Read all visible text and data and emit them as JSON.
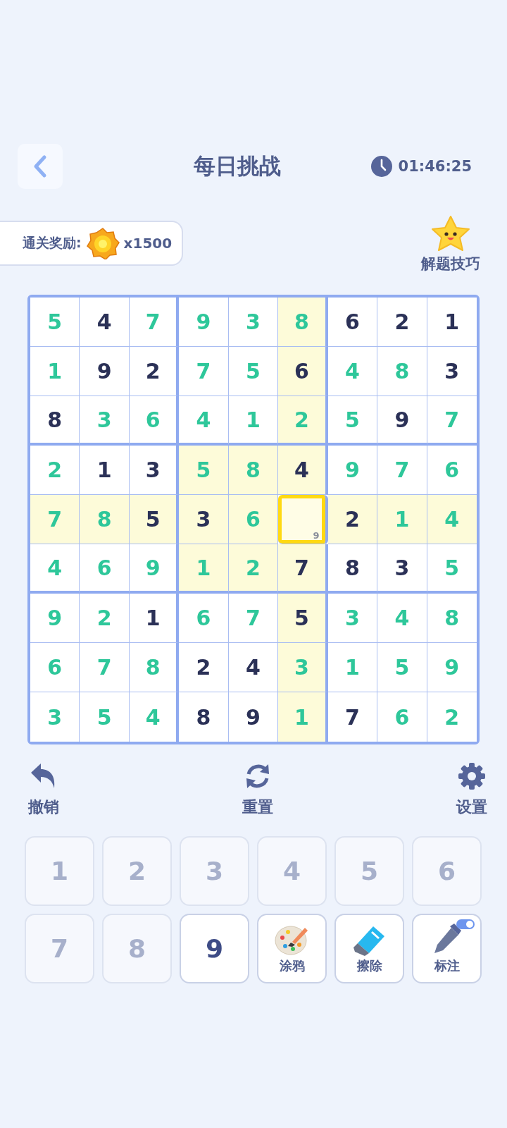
{
  "header": {
    "title": "每日挑战",
    "timer": "01:46:25"
  },
  "reward": {
    "label": "通关奖励:",
    "amount": "x1500"
  },
  "tips": {
    "label": "解题技巧"
  },
  "grid": {
    "rows": [
      [
        {
          "value": "5",
          "given": false,
          "highlighted": false,
          "selected": false
        },
        {
          "value": "4",
          "given": true,
          "highlighted": false,
          "selected": false
        },
        {
          "value": "7",
          "given": false,
          "highlighted": false,
          "selected": false
        },
        {
          "value": "9",
          "given": false,
          "highlighted": false,
          "selected": false
        },
        {
          "value": "3",
          "given": false,
          "highlighted": false,
          "selected": false
        },
        {
          "value": "8",
          "given": false,
          "highlighted": true,
          "selected": false
        },
        {
          "value": "6",
          "given": true,
          "highlighted": false,
          "selected": false
        },
        {
          "value": "2",
          "given": true,
          "highlighted": false,
          "selected": false
        },
        {
          "value": "1",
          "given": true,
          "highlighted": false,
          "selected": false
        }
      ],
      [
        {
          "value": "1",
          "given": false,
          "highlighted": false,
          "selected": false
        },
        {
          "value": "9",
          "given": true,
          "highlighted": false,
          "selected": false
        },
        {
          "value": "2",
          "given": true,
          "highlighted": false,
          "selected": false
        },
        {
          "value": "7",
          "given": false,
          "highlighted": false,
          "selected": false
        },
        {
          "value": "5",
          "given": false,
          "highlighted": false,
          "selected": false
        },
        {
          "value": "6",
          "given": true,
          "highlighted": true,
          "selected": false
        },
        {
          "value": "4",
          "given": false,
          "highlighted": false,
          "selected": false
        },
        {
          "value": "8",
          "given": false,
          "highlighted": false,
          "selected": false
        },
        {
          "value": "3",
          "given": true,
          "highlighted": false,
          "selected": false
        }
      ],
      [
        {
          "value": "8",
          "given": true,
          "highlighted": false,
          "selected": false
        },
        {
          "value": "3",
          "given": false,
          "highlighted": false,
          "selected": false
        },
        {
          "value": "6",
          "given": false,
          "highlighted": false,
          "selected": false
        },
        {
          "value": "4",
          "given": false,
          "highlighted": false,
          "selected": false
        },
        {
          "value": "1",
          "given": false,
          "highlighted": false,
          "selected": false
        },
        {
          "value": "2",
          "given": false,
          "highlighted": true,
          "selected": false
        },
        {
          "value": "5",
          "given": false,
          "highlighted": false,
          "selected": false
        },
        {
          "value": "9",
          "given": true,
          "highlighted": false,
          "selected": false
        },
        {
          "value": "7",
          "given": false,
          "highlighted": false,
          "selected": false
        }
      ],
      [
        {
          "value": "2",
          "given": false,
          "highlighted": false,
          "selected": false
        },
        {
          "value": "1",
          "given": true,
          "highlighted": false,
          "selected": false
        },
        {
          "value": "3",
          "given": true,
          "highlighted": false,
          "selected": false
        },
        {
          "value": "5",
          "given": false,
          "highlighted": true,
          "selected": false
        },
        {
          "value": "8",
          "given": false,
          "highlighted": true,
          "selected": false
        },
        {
          "value": "4",
          "given": true,
          "highlighted": true,
          "selected": false
        },
        {
          "value": "9",
          "given": false,
          "highlighted": false,
          "selected": false
        },
        {
          "value": "7",
          "given": false,
          "highlighted": false,
          "selected": false
        },
        {
          "value": "6",
          "given": false,
          "highlighted": false,
          "selected": false
        }
      ],
      [
        {
          "value": "7",
          "given": false,
          "highlighted": true,
          "selected": false
        },
        {
          "value": "8",
          "given": false,
          "highlighted": true,
          "selected": false
        },
        {
          "value": "5",
          "given": true,
          "highlighted": true,
          "selected": false
        },
        {
          "value": "3",
          "given": true,
          "highlighted": true,
          "selected": false
        },
        {
          "value": "6",
          "given": false,
          "highlighted": true,
          "selected": false
        },
        {
          "note": "9",
          "highlighted": false,
          "selected": true
        },
        {
          "value": "2",
          "given": true,
          "highlighted": true,
          "selected": false
        },
        {
          "value": "1",
          "given": false,
          "highlighted": true,
          "selected": false
        },
        {
          "value": "4",
          "given": false,
          "highlighted": true,
          "selected": false
        }
      ],
      [
        {
          "value": "4",
          "given": false,
          "highlighted": false,
          "selected": false
        },
        {
          "value": "6",
          "given": false,
          "highlighted": false,
          "selected": false
        },
        {
          "value": "9",
          "given": false,
          "highlighted": false,
          "selected": false
        },
        {
          "value": "1",
          "given": false,
          "highlighted": true,
          "selected": false
        },
        {
          "value": "2",
          "given": false,
          "highlighted": true,
          "selected": false
        },
        {
          "value": "7",
          "given": true,
          "highlighted": true,
          "selected": false
        },
        {
          "value": "8",
          "given": true,
          "highlighted": false,
          "selected": false
        },
        {
          "value": "3",
          "given": true,
          "highlighted": false,
          "selected": false
        },
        {
          "value": "5",
          "given": false,
          "highlighted": false,
          "selected": false
        }
      ],
      [
        {
          "value": "9",
          "given": false,
          "highlighted": false,
          "selected": false
        },
        {
          "value": "2",
          "given": false,
          "highlighted": false,
          "selected": false
        },
        {
          "value": "1",
          "given": true,
          "highlighted": false,
          "selected": false
        },
        {
          "value": "6",
          "given": false,
          "highlighted": false,
          "selected": false
        },
        {
          "value": "7",
          "given": false,
          "highlighted": false,
          "selected": false
        },
        {
          "value": "5",
          "given": true,
          "highlighted": true,
          "selected": false
        },
        {
          "value": "3",
          "given": false,
          "highlighted": false,
          "selected": false
        },
        {
          "value": "4",
          "given": false,
          "highlighted": false,
          "selected": false
        },
        {
          "value": "8",
          "given": false,
          "highlighted": false,
          "selected": false
        }
      ],
      [
        {
          "value": "6",
          "given": false,
          "highlighted": false,
          "selected": false
        },
        {
          "value": "7",
          "given": false,
          "highlighted": false,
          "selected": false
        },
        {
          "value": "8",
          "given": false,
          "highlighted": false,
          "selected": false
        },
        {
          "value": "2",
          "given": true,
          "highlighted": false,
          "selected": false
        },
        {
          "value": "4",
          "given": true,
          "highlighted": false,
          "selected": false
        },
        {
          "value": "3",
          "given": false,
          "highlighted": true,
          "selected": false
        },
        {
          "value": "1",
          "given": false,
          "highlighted": false,
          "selected": false
        },
        {
          "value": "5",
          "given": false,
          "highlighted": false,
          "selected": false
        },
        {
          "value": "9",
          "given": false,
          "highlighted": false,
          "selected": false
        }
      ],
      [
        {
          "value": "3",
          "given": false,
          "highlighted": false,
          "selected": false
        },
        {
          "value": "5",
          "given": false,
          "highlighted": false,
          "selected": false
        },
        {
          "value": "4",
          "given": false,
          "highlighted": false,
          "selected": false
        },
        {
          "value": "8",
          "given": true,
          "highlighted": false,
          "selected": false
        },
        {
          "value": "9",
          "given": true,
          "highlighted": false,
          "selected": false
        },
        {
          "value": "1",
          "given": false,
          "highlighted": true,
          "selected": false
        },
        {
          "value": "7",
          "given": true,
          "highlighted": false,
          "selected": false
        },
        {
          "value": "6",
          "given": false,
          "highlighted": false,
          "selected": false
        },
        {
          "value": "2",
          "given": false,
          "highlighted": false,
          "selected": false
        }
      ]
    ]
  },
  "actions": [
    {
      "kind": "undo",
      "label": "撤销"
    },
    {
      "kind": "reset",
      "label": "重置"
    },
    {
      "kind": "settings",
      "label": "设置"
    }
  ],
  "keypad": [
    {
      "kind": "digit",
      "label": "1",
      "disabled": true
    },
    {
      "kind": "digit",
      "label": "2",
      "disabled": true
    },
    {
      "kind": "digit",
      "label": "3",
      "disabled": true
    },
    {
      "kind": "digit",
      "label": "4",
      "disabled": true
    },
    {
      "kind": "digit",
      "label": "5",
      "disabled": true
    },
    {
      "kind": "digit",
      "label": "6",
      "disabled": true
    },
    {
      "kind": "digit",
      "label": "7",
      "disabled": true
    },
    {
      "kind": "digit",
      "label": "8",
      "disabled": true
    },
    {
      "kind": "digit",
      "label": "9",
      "disabled": false
    },
    {
      "kind": "doodle",
      "label": "涂鸦"
    },
    {
      "kind": "erase",
      "label": "擦除"
    },
    {
      "kind": "mark",
      "label": "标注",
      "on": true
    }
  ]
}
